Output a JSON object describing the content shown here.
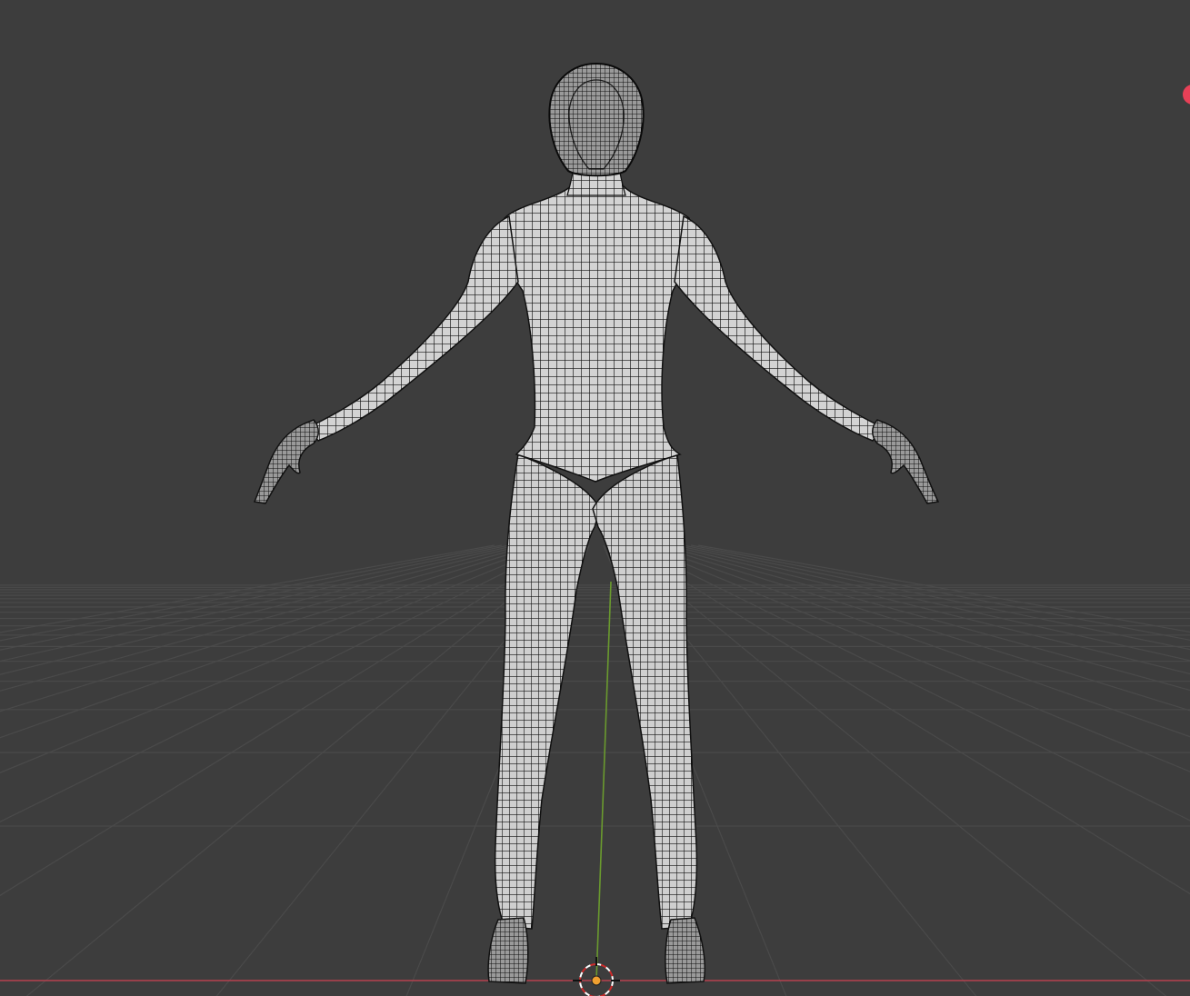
{
  "app": {
    "view": "3D Viewport",
    "shading": "wireframe-overlay",
    "perspective": "front-perspective"
  },
  "colors": {
    "background": "#3d3d3d",
    "grid_line": "#4a4a4a",
    "x_axis": "#b5414f",
    "y_axis": "#6a9a2e",
    "mesh_fill": "#d3d3d3",
    "mesh_wire": "#111111",
    "gizmo_dot": "#e84057",
    "cursor_red": "#cc2a2a",
    "cursor_white": "#ffffff",
    "origin_dot": "#f0a030"
  },
  "scene": {
    "object": "character-mesh",
    "icons": {
      "cursor": "3d-cursor-icon",
      "origin": "object-origin-icon",
      "gizmo": "navigation-gizmo-icon"
    }
  }
}
